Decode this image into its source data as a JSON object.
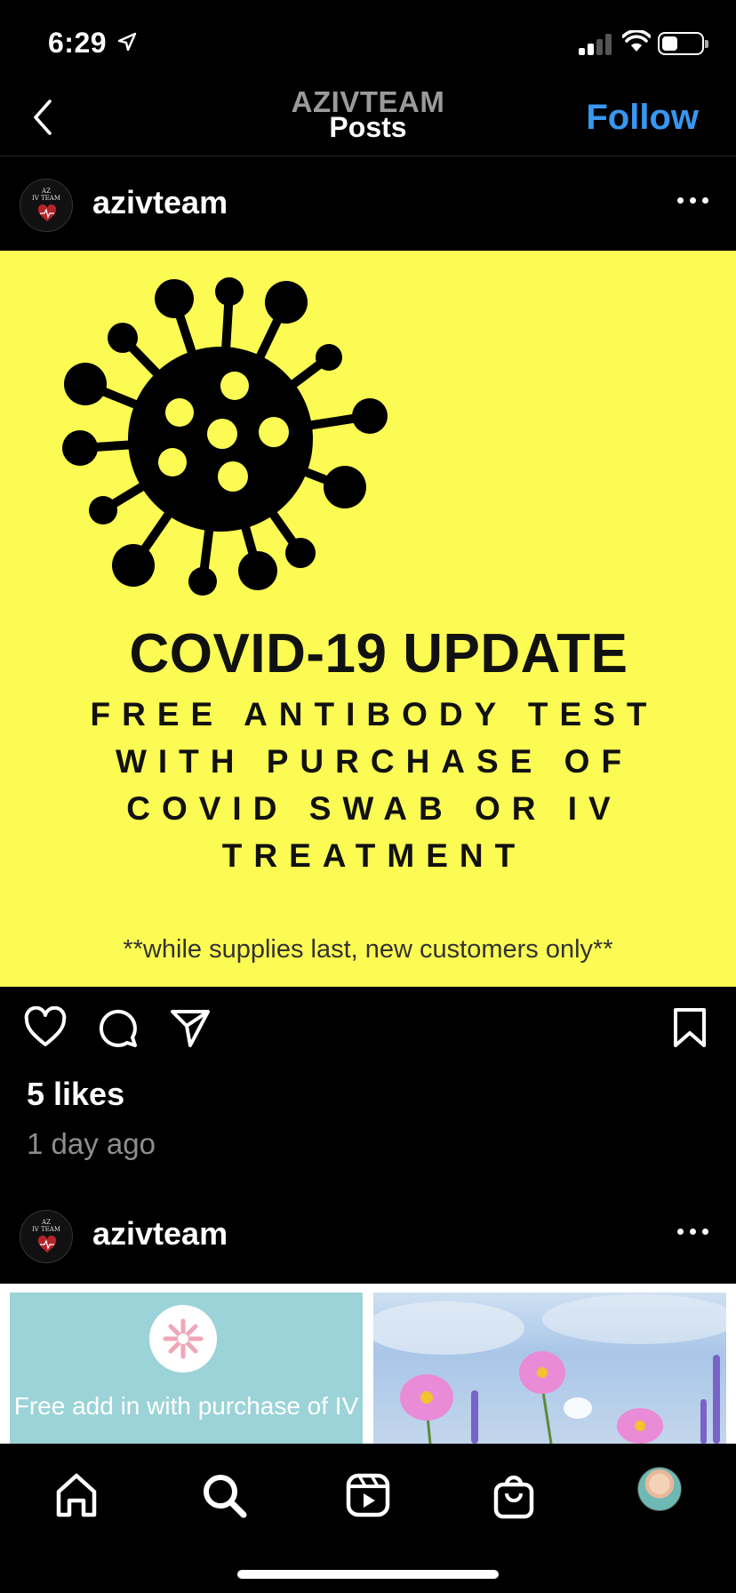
{
  "status_bar": {
    "time": "6:29",
    "battery_level": 0.4
  },
  "header": {
    "account": "AZIVTEAM",
    "subtitle": "Posts",
    "follow_label": "Follow"
  },
  "posts": [
    {
      "username": "azivteam",
      "avatar_text_line1": "AZ",
      "avatar_text_line2": "IV TEAM",
      "image": {
        "background_color": "#fbfb53",
        "title": "COVID-19 UPDATE",
        "body_lines": [
          "FREE ANTIBODY TEST",
          "WITH PURCHASE OF",
          "COVID SWAB OR IV",
          "TREATMENT"
        ],
        "footnote": "**while supplies last, new customers only**"
      },
      "likes": "5 likes",
      "time_ago": "1 day ago"
    },
    {
      "username": "azivteam",
      "avatar_text_line1": "AZ",
      "avatar_text_line2": "IV TEAM",
      "thumb_left_text": "Free add in with purchase of IV"
    }
  ],
  "colors": {
    "accent": "#3897f0",
    "background": "#000000",
    "secondary_text": "#8e8e8e"
  },
  "icons": {
    "actions": [
      "heart-icon",
      "comment-icon",
      "share-icon",
      "bookmark-icon"
    ],
    "tabbar": [
      "home-icon",
      "search-icon",
      "reels-icon",
      "shop-icon",
      "profile-avatar"
    ]
  }
}
